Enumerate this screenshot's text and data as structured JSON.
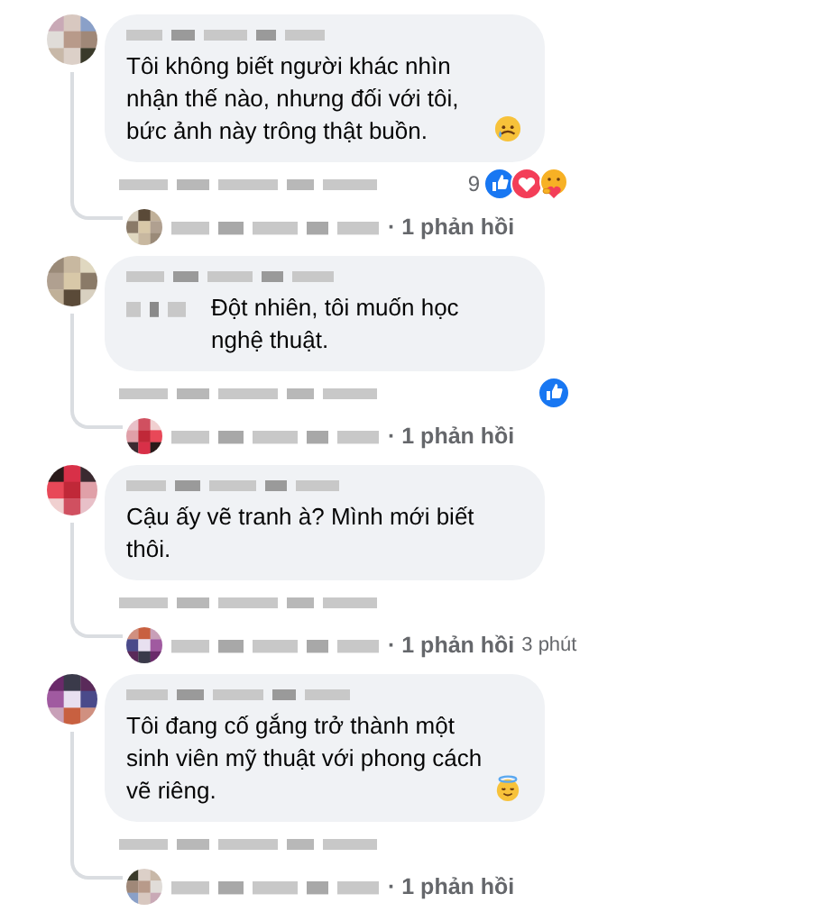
{
  "comments": [
    {
      "text": "Tôi không biết người khác nhìn nhận thế nào, nhưng đối với tôi, bức ảnh này trông thật buồn.",
      "mention": false,
      "emoji": {
        "kind": "sad"
      },
      "reaction_count": "9",
      "reactions": [
        {
          "kind": "like"
        },
        {
          "kind": "love"
        },
        {
          "kind": "care"
        }
      ],
      "reply": {
        "count": "· 1 phản hồi"
      }
    },
    {
      "text": "Đột nhiên, tôi muốn học nghệ thuật.",
      "mention": true,
      "reactions": [
        {
          "kind": "like"
        }
      ],
      "reply": {
        "count": "· 1 phản hồi"
      }
    },
    {
      "text": "Cậu ấy vẽ tranh à? Mình mới biết thôi.",
      "mention": false,
      "reply": {
        "count": "· 1 phản hồi",
        "time": "3 phút"
      }
    },
    {
      "text": "Tôi đang cố gắng trở thành một sinh viên mỹ thuật với phong cách vẽ riêng.",
      "mention": false,
      "emoji": {
        "kind": "halo"
      },
      "reply": {
        "count": "· 1 phản hồi"
      }
    }
  ]
}
